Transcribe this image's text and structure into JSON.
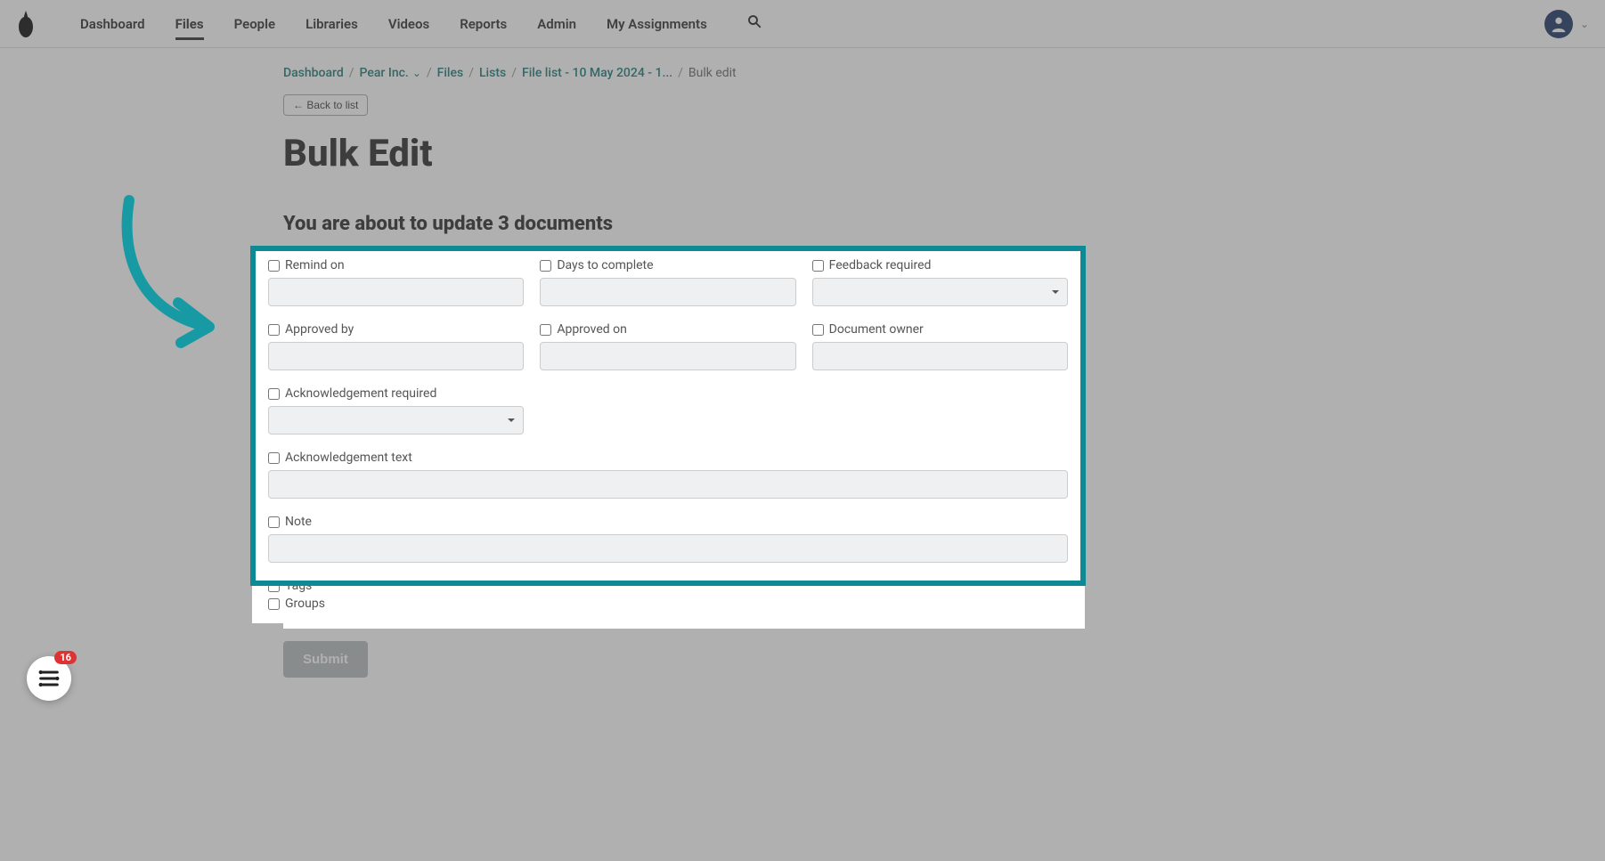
{
  "nav": {
    "items": [
      "Dashboard",
      "Files",
      "People",
      "Libraries",
      "Videos",
      "Reports",
      "Admin",
      "My Assignments"
    ],
    "active_index": 1
  },
  "breadcrumb": {
    "items": [
      {
        "label": "Dashboard",
        "link": true
      },
      {
        "label": "Pear Inc.",
        "link": true,
        "dropdown": true
      },
      {
        "label": "Files",
        "link": true
      },
      {
        "label": "Lists",
        "link": true
      },
      {
        "label": "File list - 10 May 2024 - 1...",
        "link": true
      },
      {
        "label": "Bulk edit",
        "link": false
      }
    ]
  },
  "back_button": "← Back to list",
  "page_title": "Bulk Edit",
  "subheading": "You are about to update 3 documents",
  "fields": {
    "remind_on": {
      "label": "Remind on",
      "type": "text"
    },
    "days_to_complete": {
      "label": "Days to complete",
      "type": "text"
    },
    "feedback_required": {
      "label": "Feedback required",
      "type": "select"
    },
    "approved_by": {
      "label": "Approved by",
      "type": "text"
    },
    "approved_on": {
      "label": "Approved on",
      "type": "text"
    },
    "document_owner": {
      "label": "Document owner",
      "type": "text"
    },
    "ack_required": {
      "label": "Acknowledgement required",
      "type": "select"
    },
    "ack_text": {
      "label": "Acknowledgement text",
      "type": "text"
    },
    "note": {
      "label": "Note",
      "type": "text"
    },
    "tags": {
      "label": "Tags",
      "type": "check"
    },
    "groups": {
      "label": "Groups",
      "type": "check"
    }
  },
  "submit_label": "Submit",
  "help_badge": "16",
  "colors": {
    "accent_teal": "#0d8a94",
    "breadcrumb_link": "#1a7d7a"
  }
}
